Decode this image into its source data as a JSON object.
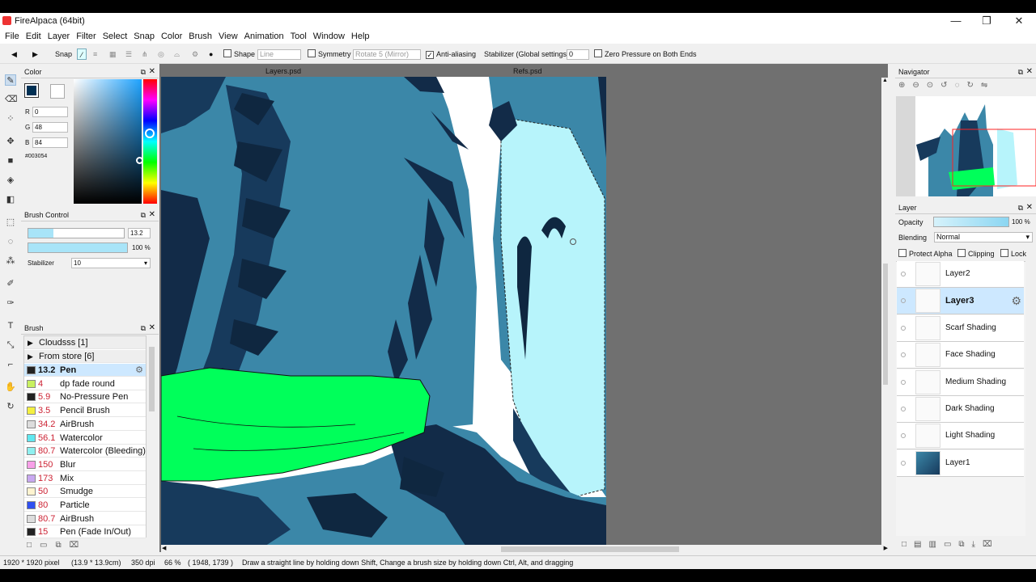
{
  "window": {
    "title": "FireAlpaca (64bit)",
    "minimize": "—",
    "maximize": "❐",
    "close": "✕"
  },
  "menus": [
    "File",
    "Edit",
    "Layer",
    "Filter",
    "Select",
    "Snap",
    "Color",
    "Brush",
    "View",
    "Animation",
    "Tool",
    "Window",
    "Help"
  ],
  "toolbar": {
    "snap_label": "Snap",
    "shape_label": "Shape",
    "shape_value": "Line",
    "symmetry_label": "Symmetry",
    "symmetry_value": "Rotate 5 (Mirror)",
    "antialiasing_label": "Anti-aliasing",
    "antialiasing_checked": true,
    "stabilizer_label": "Stabilizer (Global settings)",
    "stabilizer_value": "0",
    "zero_pressure_label": "Zero Pressure on Both Ends"
  },
  "tabs": {
    "left": "Layers.psd",
    "right": "Refs.psd"
  },
  "color_panel": {
    "title": "Color",
    "r_label": "R",
    "r_value": "0",
    "g_label": "G",
    "g_value": "48",
    "b_label": "B",
    "b_value": "84",
    "hex": "#003054",
    "primary_color": "#003054"
  },
  "brush_control": {
    "title": "Brush Control",
    "size_value": "13.2",
    "opacity_value": "100 %",
    "stabilizer_label": "Stabilizer",
    "stabilizer_value": "10"
  },
  "brush_panel": {
    "title": "Brush",
    "groups": [
      {
        "label": "Cloudsss [1]"
      },
      {
        "label": "From store [6]"
      }
    ],
    "items": [
      {
        "size": "13.2",
        "name": "Pen",
        "color": "#222222",
        "selected": true
      },
      {
        "size": "4",
        "name": "dp fade round",
        "color": "#c8f060"
      },
      {
        "size": "5.9",
        "name": "No-Pressure Pen",
        "color": "#222222"
      },
      {
        "size": "3.5",
        "name": "Pencil Brush",
        "color": "#f4f040"
      },
      {
        "size": "34.2",
        "name": "AirBrush",
        "color": "#dddddd"
      },
      {
        "size": "56.1",
        "name": "Watercolor",
        "color": "#60e8f0"
      },
      {
        "size": "80.7",
        "name": "Watercolor (Bleeding)",
        "color": "#90f0f0"
      },
      {
        "size": "150",
        "name": "Blur",
        "color": "#f8a0e8"
      },
      {
        "size": "173",
        "name": "Mix",
        "color": "#c8a8f0"
      },
      {
        "size": "50",
        "name": "Smudge",
        "color": "#fff4d0"
      },
      {
        "size": "80",
        "name": "Particle",
        "color": "#3050f0"
      },
      {
        "size": "80.7",
        "name": "AirBrush",
        "color": "#dddddd"
      },
      {
        "size": "15",
        "name": "Pen (Fade In/Out)",
        "color": "#222222"
      }
    ]
  },
  "navigator": {
    "title": "Navigator"
  },
  "layer_panel": {
    "title": "Layer",
    "opacity_label": "Opacity",
    "opacity_value": "100 %",
    "blending_label": "Blending",
    "blending_value": "Normal",
    "protect_alpha_label": "Protect Alpha",
    "clipping_label": "Clipping",
    "lock_label": "Lock",
    "layers": [
      {
        "name": "Layer2"
      },
      {
        "name": "Layer3",
        "selected": true
      },
      {
        "name": "Scarf Shading"
      },
      {
        "name": "Face Shading"
      },
      {
        "name": "Medium Shading"
      },
      {
        "name": "Dark Shading"
      },
      {
        "name": "Light Shading"
      },
      {
        "name": "Layer1"
      }
    ]
  },
  "status": {
    "pixels": "1920 * 1920 pixel",
    "cm": "(13.9 * 13.9cm)",
    "dpi": "350 dpi",
    "zoom": "66 %",
    "coords": "( 1948, 1739 )",
    "hint": "Draw a straight line by holding down Shift, Change a brush size by holding down Ctrl, Alt, and dragging"
  }
}
